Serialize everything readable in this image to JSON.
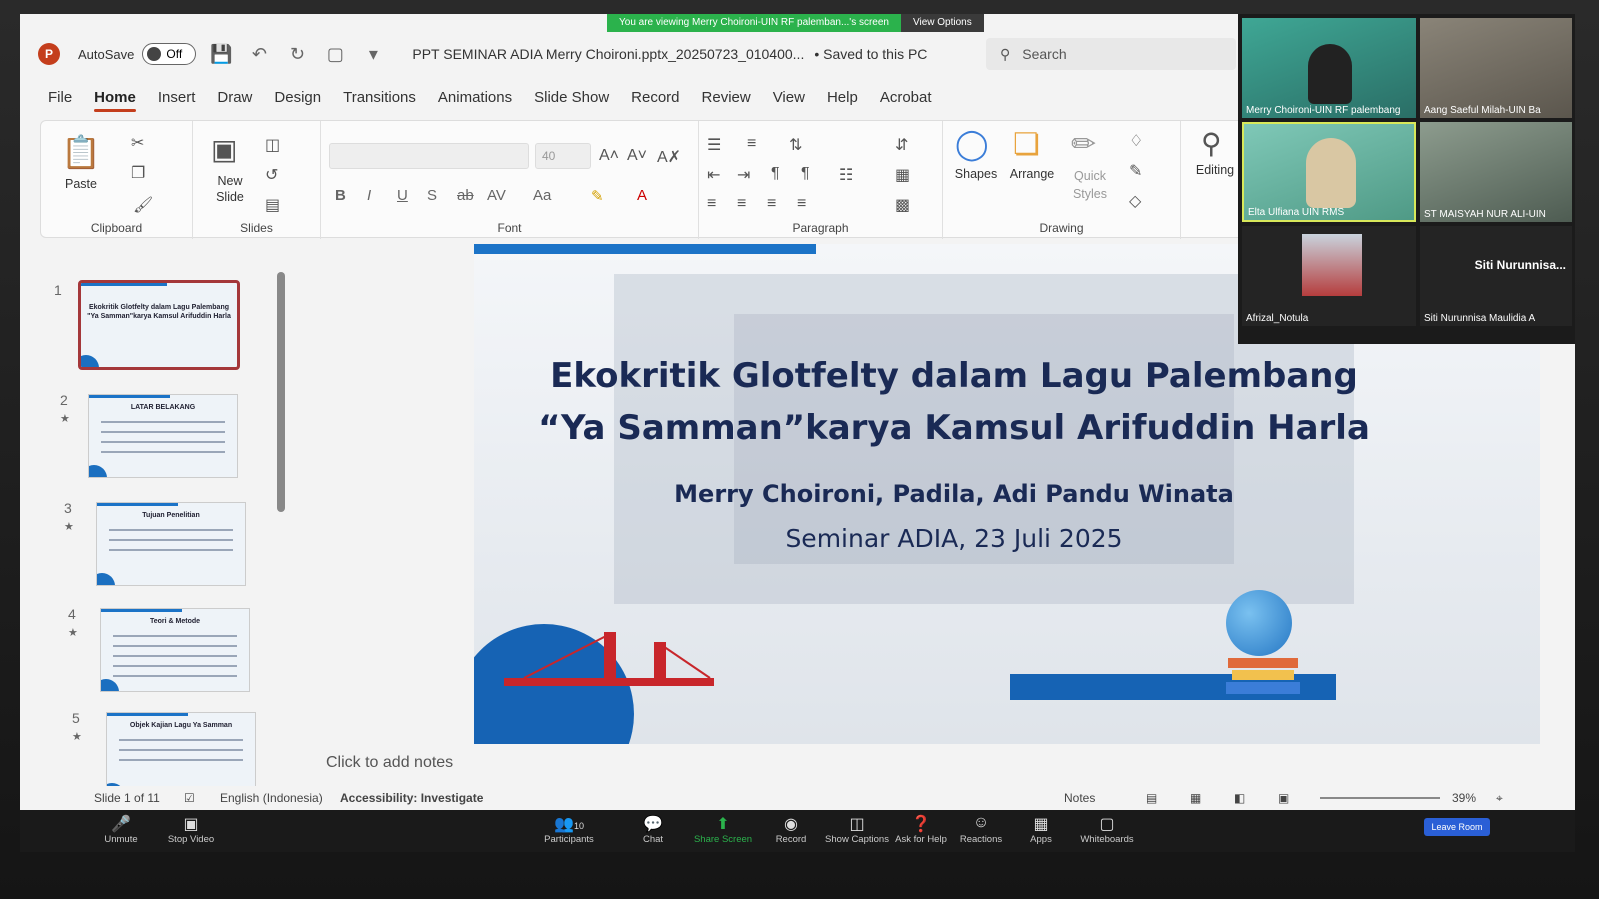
{
  "zoom_share": {
    "banner": "You are viewing Merry Choironi-UIN RF palemban...'s screen",
    "view_options": "View Options"
  },
  "titlebar": {
    "app_icon": "P",
    "autosave_label": "AutoSave",
    "autosave_state": "Off",
    "document_title": "PPT SEMINAR ADIA Merry Choironi.pptx_20250723_010400...",
    "saved_status": "• Saved to this PC",
    "search_placeholder": "Search"
  },
  "menu": {
    "tabs": [
      "File",
      "Home",
      "Insert",
      "Draw",
      "Design",
      "Transitions",
      "Animations",
      "Slide Show",
      "Record",
      "Review",
      "View",
      "Help",
      "Acrobat"
    ]
  },
  "ribbon": {
    "clipboard": {
      "label": "Clipboard",
      "paste": "Paste"
    },
    "slides": {
      "label": "Slides",
      "new_slide_line1": "New",
      "new_slide_line2": "Slide"
    },
    "font": {
      "label": "Font",
      "size": "40"
    },
    "paragraph": {
      "label": "Paragraph"
    },
    "drawing": {
      "label": "Drawing",
      "shapes": "Shapes",
      "arrange": "Arrange",
      "quick_styles_line1": "Quick",
      "quick_styles_line2": "Styles"
    },
    "editing": {
      "label": "Editing"
    }
  },
  "thumbnails": [
    {
      "num": "1",
      "title": "Ekokritik Glotfelty dalam Lagu Palembang \"Ya Samman\"karya Kamsul Arifuddin Harla"
    },
    {
      "num": "2",
      "title": "LATAR BELAKANG"
    },
    {
      "num": "3",
      "title": "Tujuan Penelitian"
    },
    {
      "num": "4",
      "title": "Teori & Metode"
    },
    {
      "num": "5",
      "title": "Objek Kajian Lagu Ya Samman"
    }
  ],
  "slide": {
    "title_line1": "Ekokritik Glotfelty dalam Lagu Palembang",
    "title_line2": "“Ya Samman”karya Kamsul Arifuddin Harla",
    "authors": "Merry Choironi, Padila, Adi Pandu Winata",
    "event": "Seminar ADIA, 23 Juli 2025"
  },
  "notes_placeholder": "Click to add notes",
  "statusbar": {
    "slide_info": "Slide 1 of 11",
    "language": "English (Indonesia)",
    "accessibility": "Accessibility: Investigate",
    "notes": "Notes",
    "zoom": "39%"
  },
  "zoom_toolbar": {
    "unmute": "Unmute",
    "stop_video": "Stop Video",
    "participants": "Participants",
    "participant_count": "10",
    "chat": "Chat",
    "share_screen": "Share Screen",
    "record": "Record",
    "show_captions": "Show Captions",
    "ask_for_help": "Ask for Help",
    "reactions": "Reactions",
    "apps": "Apps",
    "whiteboards": "Whiteboards",
    "leave_room": "Leave Room"
  },
  "participants_panel": [
    {
      "name": "Merry Choironi-UIN RF palembang"
    },
    {
      "name": "Aang Saeful Milah-UIN Ba"
    },
    {
      "name": "Elta Ulfiana UIN RMS"
    },
    {
      "name": "ST MAISYAH NUR ALI-UIN"
    },
    {
      "name": "Afrizal_Notula"
    },
    {
      "name": "Siti Nurunnisa Maulidia A",
      "display": "Siti  Nurunnisa..."
    }
  ],
  "colors": {
    "ppt_accent": "#c43e1c",
    "slide_title": "#1a2a55",
    "slide_blue": "#1663b4",
    "share_green": "#2bb24c"
  }
}
